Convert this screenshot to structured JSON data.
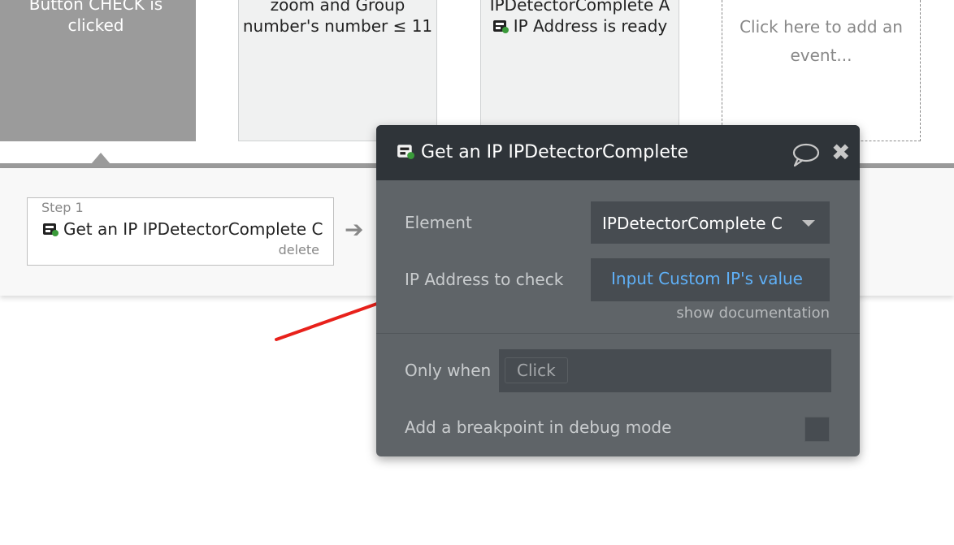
{
  "events": [
    {
      "lines": [
        "Button CHECK is",
        "clicked"
      ]
    },
    {
      "lines": [
        "zoom and Group",
        "number's number ≤ 11"
      ]
    },
    {
      "lines": [
        "IPDetectorComplete A",
        "IP Address is ready"
      ]
    },
    {
      "lines": [
        "Click here to add an",
        "event..."
      ]
    }
  ],
  "step": {
    "number_label": "Step 1",
    "title": "Get an IP IPDetectorComplete C",
    "delete_label": "delete"
  },
  "popup": {
    "title": "Get an IP IPDetectorComplete",
    "element_label": "Element",
    "element_value": "IPDetectorComplete C",
    "ip_label": "IP Address to check",
    "ip_value": "Input Custom IP's value",
    "docs_link": "show documentation",
    "only_when_label": "Only when",
    "only_when_value": "Click",
    "breakpoint_label": "Add a breakpoint in debug mode"
  },
  "icons": {
    "plugin": "plugin-icon",
    "arrow": "arrow-right-icon",
    "comment": "comment-icon",
    "close": "close-icon",
    "caret": "caret-down-icon"
  },
  "colors": {
    "popup_bg": "#5f6468",
    "popup_header": "#2f3439",
    "link_blue": "#5fb0f7",
    "annotation_red": "#e8211b"
  }
}
